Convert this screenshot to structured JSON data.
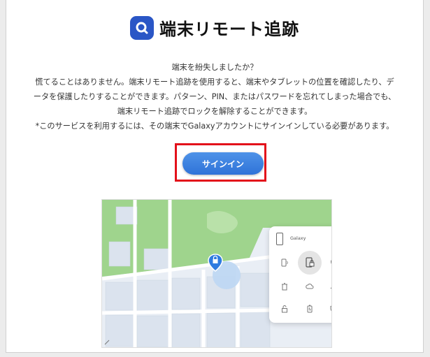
{
  "header": {
    "title": "端末リモート追跡",
    "icon": "search-app-icon",
    "icon_color": "#2a56c6"
  },
  "description": {
    "line1": "端末を紛失しましたか？",
    "line2": "慌てることはありません。端末リモート追跡を使用すると、端末やタブレットの位置を確認したり、デ",
    "line3": "ータを保護したりすることができます。パターン、PIN、またはパスワードを忘れてしまった場合でも、",
    "line4": "端末リモート追跡でロックを解除することができます。",
    "line5": "*このサービスを利用するには、その端末でGalaxyアカウントにサインインしている必要があります。"
  },
  "signin": {
    "label": "サインイン",
    "color": "#2f72d8",
    "highlight_color": "#e3101a"
  },
  "device_panel": {
    "device_name": "Galaxy",
    "actions": [
      "ring-icon",
      "lock-icon",
      "location-icon",
      "erase-icon",
      "backup-icon",
      "track-icon",
      "unlock-icon",
      "battery-icon",
      "shield-icon"
    ]
  }
}
